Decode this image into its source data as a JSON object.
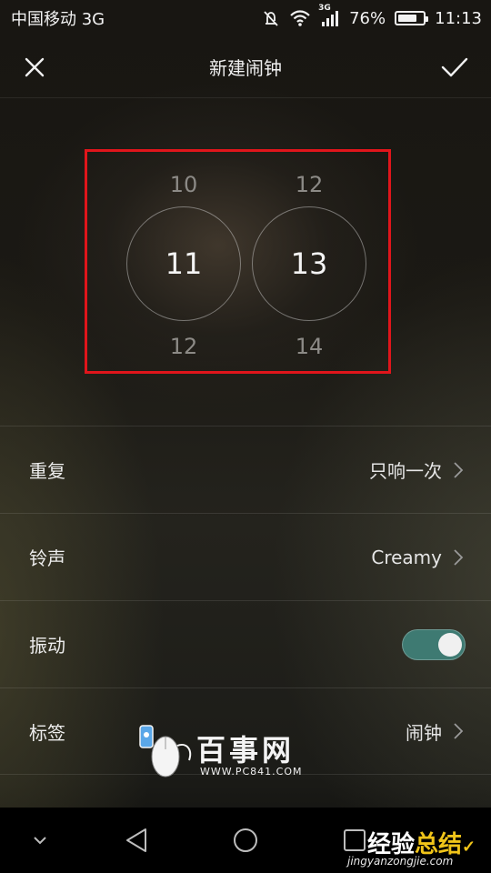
{
  "status_bar": {
    "carrier": "中国移动 3G",
    "network_tag": "3G",
    "battery": "76%",
    "battery_level": 0.76,
    "time": "11:13",
    "icons": [
      "mute-icon",
      "wifi-icon",
      "signal-icon",
      "battery-icon"
    ]
  },
  "header": {
    "title": "新建闹钟",
    "close_icon": "close-icon",
    "confirm_icon": "check-icon"
  },
  "time_picker": {
    "hours": {
      "prev": "10",
      "selected": "11",
      "next": "12"
    },
    "minutes": {
      "prev": "12",
      "selected": "13",
      "next": "14"
    },
    "highlight_color": "#e0151b"
  },
  "settings": [
    {
      "label": "重复",
      "value": "只响一次",
      "control": "chevron"
    },
    {
      "label": "铃声",
      "value": "Creamy",
      "control": "chevron"
    },
    {
      "label": "振动",
      "value": "",
      "control": "toggle",
      "on": true
    },
    {
      "label": "标签",
      "value": "闹钟",
      "control": "chevron"
    }
  ],
  "watermark": {
    "title": "百事网",
    "url": "WWW.PC841.COM"
  },
  "corner_logo": {
    "title_a": "经验",
    "title_b": "总结",
    "url": "jingyanzongjie.com"
  },
  "colors": {
    "toggle_on": "#3e7a72",
    "accent_yellow": "#f0c419"
  }
}
